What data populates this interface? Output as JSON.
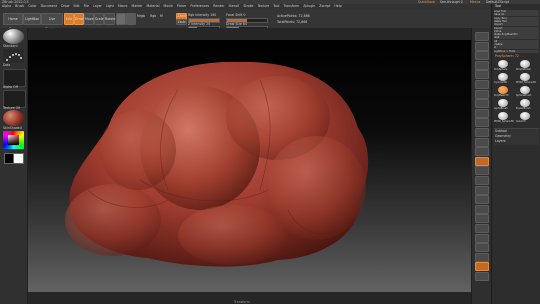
{
  "titlebar": {
    "left_text": "ZBrush 2022.0.5",
    "right_items": [
      "QuickSave",
      "See-through 0",
      "Menus",
      "DefaultZScript"
    ]
  },
  "menubar": {
    "items": [
      "Alpha",
      "Brush",
      "Color",
      "Document",
      "Draw",
      "Edit",
      "File",
      "Layer",
      "Light",
      "Macro",
      "Marker",
      "Material",
      "Movie",
      "Picker",
      "Preferences",
      "Render",
      "Stencil",
      "Stroke",
      "Texture",
      "Tool",
      "Transform",
      "Zplugin",
      "Zscript",
      "Help"
    ]
  },
  "toolbar": {
    "home_page": "Home Page",
    "lightbox": "LightBox",
    "live_boolean": "Live Boolean",
    "edit": "Edit",
    "draw": "Draw",
    "move": "Move",
    "scale": "Scale",
    "rotate": "Rotate",
    "mrgb": "Mrgb",
    "rgb": "Rgb",
    "m": "M",
    "zadd": "Zadd",
    "zsub": "Zsub",
    "focal_shift_label": "Focal Shift 0",
    "draw_size_label": "Draw Size 64",
    "z_intensity_label": "Z Intensity 25",
    "rgb_intensity_label": "Rgb Intensity 100",
    "active_points": "ActivePoints: 72,866",
    "total_points": "TotalPoints: 72,866",
    "z_intensity_level": 0.25,
    "rgb_intensity_level": 1.0,
    "focal_level": 0.5,
    "draw_size_level": 0.3
  },
  "left_shelf": {
    "brush_label": "Standard",
    "stroke_label": "Dots",
    "alpha_label": "Alpha Off",
    "texture_label": "Texture Off",
    "material_label": "SkinShade4"
  },
  "right_panel": {
    "title": "Tool",
    "rows": [
      "Load Tool",
      "Save As",
      "Copy Tool",
      "Paste Tool",
      "Import",
      "Export",
      "Clone",
      "Make PolyMesh3D",
      "GoZ",
      "All",
      "Visible",
      "R",
      "Lightbox > Tools"
    ],
    "current_tool_label": "PolySphere: 72",
    "thumbnails": [
      "PolySphere",
      "SimpleBrush",
      "Cylinder3D",
      "PM3D_Sphere3D",
      "PolyMesh3D",
      "SphereBrush",
      "AlphaBrush",
      "EraserBrush",
      "PM3D_Sphere3D_1",
      "Cube3D"
    ],
    "subtool_label": "Subtool",
    "geometry_label": "Geometry",
    "layers_label": "Layers"
  },
  "status": {
    "center_text": "Transform"
  },
  "colors": {
    "accent": "#d97c2b",
    "model": "#9c3a2e",
    "panel": "#2d2d2d"
  }
}
